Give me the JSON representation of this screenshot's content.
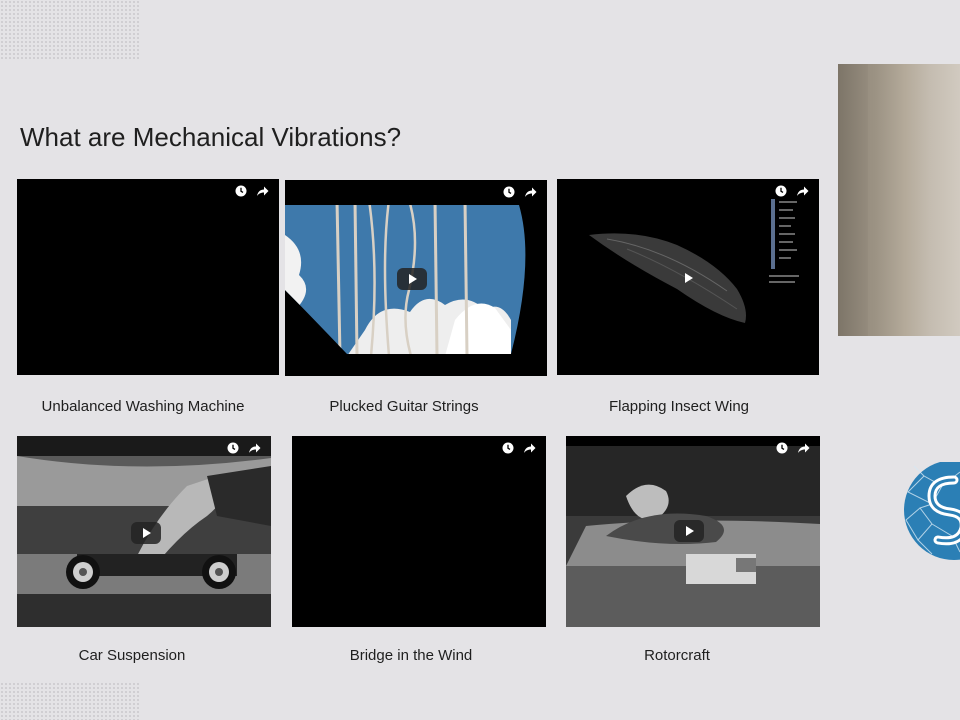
{
  "slide": {
    "title": "What are Mechanical Vibrations?"
  },
  "videos": [
    {
      "caption": "Unbalanced Washing Machine",
      "icons": [
        "clock-icon",
        "share-icon"
      ],
      "has_play_button": false
    },
    {
      "caption": "Plucked Guitar Strings",
      "icons": [
        "clock-icon",
        "share-icon"
      ],
      "has_play_button": true
    },
    {
      "caption": "Flapping Insect Wing",
      "icons": [
        "clock-icon",
        "share-icon"
      ],
      "has_play_button": true
    },
    {
      "caption": "Car Suspension",
      "icons": [
        "clock-icon",
        "share-icon"
      ],
      "has_play_button": true
    },
    {
      "caption": "Bridge in the Wind",
      "icons": [
        "clock-icon",
        "share-icon"
      ],
      "has_play_button": false
    },
    {
      "caption": "Rotorcraft",
      "icons": [
        "clock-icon",
        "share-icon"
      ],
      "has_play_button": true
    }
  ],
  "colors": {
    "background": "#e4e3e6",
    "video_background": "#000000",
    "text": "#1f1f1f",
    "logo": "#2b7fb5"
  }
}
